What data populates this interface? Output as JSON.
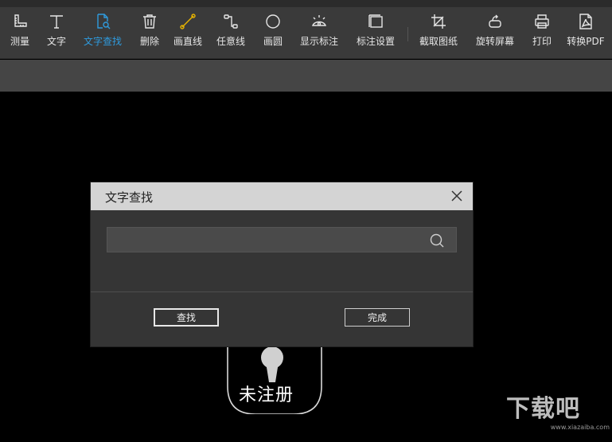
{
  "toolbar": {
    "tools": [
      {
        "label": "测量",
        "icon": "measure-icon"
      },
      {
        "label": "文字",
        "icon": "text-icon"
      },
      {
        "label": "文字查找",
        "icon": "text-search-icon"
      },
      {
        "label": "删除",
        "icon": "delete-icon"
      },
      {
        "label": "画直线",
        "icon": "line-icon"
      },
      {
        "label": "任意线",
        "icon": "freeline-icon"
      },
      {
        "label": "画圆",
        "icon": "circle-icon"
      },
      {
        "label": "显示标注",
        "icon": "show-annotation-icon"
      },
      {
        "label": "标注设置",
        "icon": "annotation-settings-icon"
      },
      {
        "label": "截取图纸",
        "icon": "crop-icon"
      },
      {
        "label": "旋转屏幕",
        "icon": "rotate-icon"
      },
      {
        "label": "打印",
        "icon": "print-icon"
      },
      {
        "label": "转换PDF",
        "icon": "pdf-icon"
      }
    ],
    "active_color": "#2f9bde",
    "line_tool_color": "#e8b400"
  },
  "dialog": {
    "title": "文字查找",
    "search_value": "",
    "find_label": "查找",
    "done_label": "完成"
  },
  "canvas": {
    "unregistered_text": "未注册"
  },
  "watermark": {
    "text": "下载吧",
    "url": "www.xiazaiba.com"
  }
}
